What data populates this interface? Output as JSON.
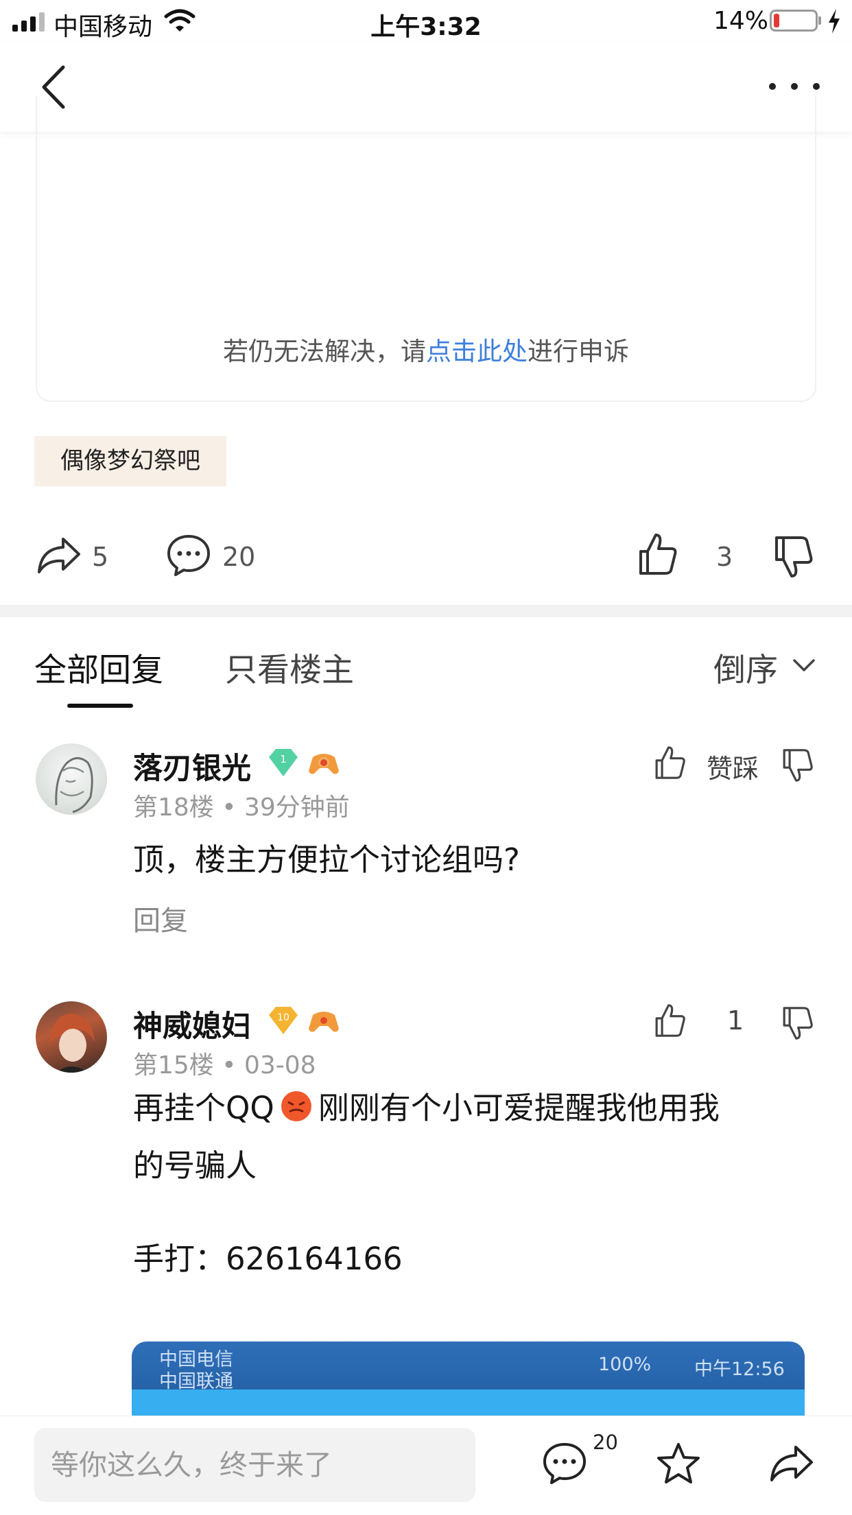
{
  "status_bar": {
    "carrier": "中国移动",
    "time": "上午3:32",
    "battery_percent": "14%",
    "battery_level": 0.14,
    "battery_color": "#e53935"
  },
  "nav": {
    "back_icon": "chevron-left-icon",
    "more_icon": "more-dots-icon"
  },
  "post": {
    "appeal_prefix": "若仍无法解决，请",
    "appeal_link": "点击此处",
    "appeal_suffix": "进行申诉",
    "forum_tag": "偶像梦幻祭吧",
    "share_count": "5",
    "comment_count": "20",
    "like_count": "3"
  },
  "tabs": {
    "all": "全部回复",
    "op_only": "只看楼主",
    "sort": "倒序"
  },
  "comments": [
    {
      "username": "落刃银光",
      "level_badge": "1",
      "floor": "第18楼",
      "time": "39分钟前",
      "text": "顶，楼主方便拉个讨论组吗?",
      "vote_label": "赞踩",
      "reply_label": "回复"
    },
    {
      "username": "神威媳妇",
      "level_badge": "10",
      "floor": "第15楼",
      "time": "03-08",
      "text_line1_a": "再挂个QQ",
      "text_line1_b": "刚刚有个小可爱提醒我他用我",
      "text_line2": "的号骗人",
      "text_line3": "手打：626164166",
      "likes": "1",
      "screenshot": {
        "carrier1": "中国电信",
        "carrier2": "中国联通",
        "status_right": "100%",
        "time": "中午12:56"
      }
    }
  ],
  "bottom_bar": {
    "input_placeholder": "等你这么久，终于来了",
    "comment_badge": "20"
  },
  "colors": {
    "link": "#3f7fdc",
    "tag_bg": "#f8efe6",
    "gem_green": "#52d1a3",
    "gem_gold": "#f4b431"
  }
}
